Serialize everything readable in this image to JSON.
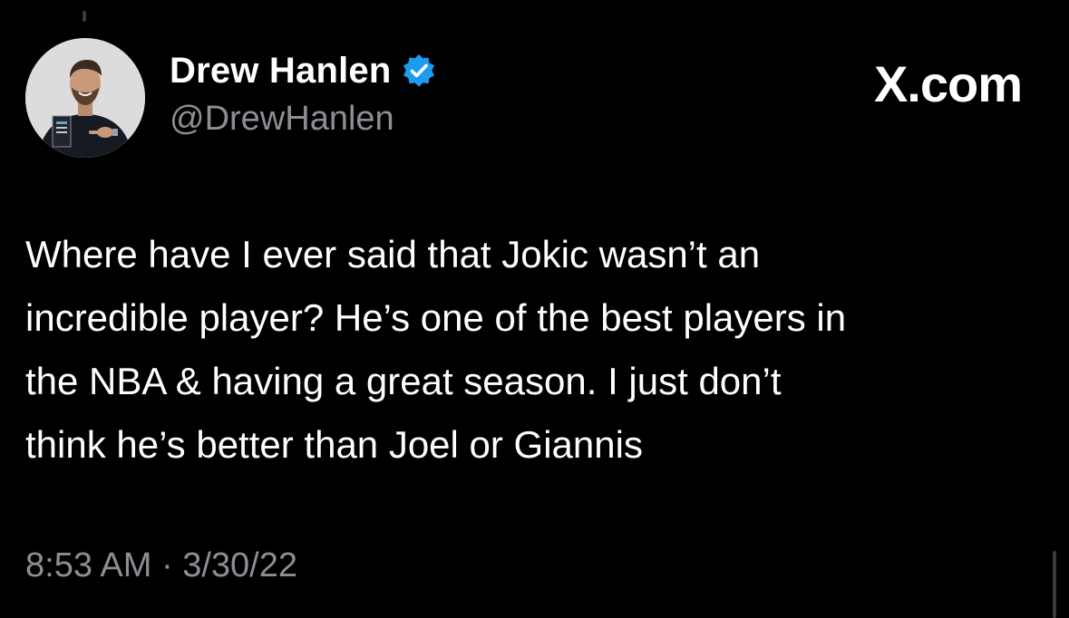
{
  "user": {
    "display_name": "Drew Hanlen",
    "handle": "@DrewHanlen",
    "verified": true,
    "avatar_icon": "profile-photo-icon",
    "badge_color": "#1d9bf0"
  },
  "site": {
    "label": "X.com"
  },
  "tweet": {
    "text": "Where have I ever said that Jokic wasn’t an\nincredible player? He’s one of the best players in\nthe NBA & having a great season. I just don’t\nthink he’s better than Joel or Giannis",
    "timestamp": "8:53 AM · 3/30/22"
  },
  "colors": {
    "background": "#000000",
    "text_primary": "#ffffff",
    "text_secondary": "#8b8f94"
  }
}
